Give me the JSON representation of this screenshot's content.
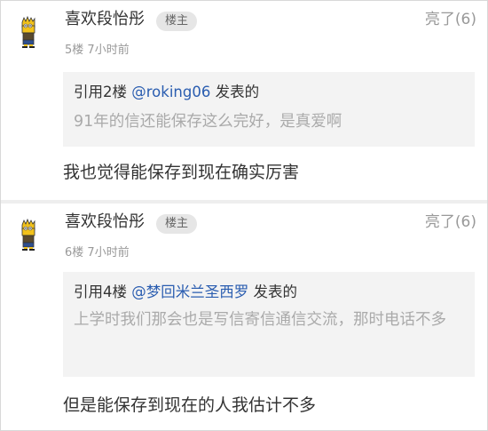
{
  "posts": [
    {
      "username": "喜欢段怡彤",
      "badge": "楼主",
      "likes": "亮了(6)",
      "floor": "5楼",
      "time": "7小时前",
      "quote": {
        "prefix": "引用2楼 ",
        "mention": "@roking06",
        "suffix": " 发表的",
        "text": "91年的信还能保存这么完好，是真爱啊"
      },
      "reply": "我也觉得能保存到现在确实厉害"
    },
    {
      "username": "喜欢段怡彤",
      "badge": "楼主",
      "likes": "亮了(6)",
      "floor": "6楼",
      "time": "7小时前",
      "quote": {
        "prefix": "引用4楼 ",
        "mention": "@梦回米兰圣西罗",
        "suffix": " 发表的",
        "text": "上学时我们那会也是写信寄信通信交流，那时电话不多"
      },
      "reply": "但是能保存到现在的人我估计不多"
    }
  ],
  "colors": {
    "mention": "#2a5db0",
    "quote_background": "#f3f3f3",
    "badge_background": "#e6e6e6",
    "separator": "#eeeeee"
  }
}
